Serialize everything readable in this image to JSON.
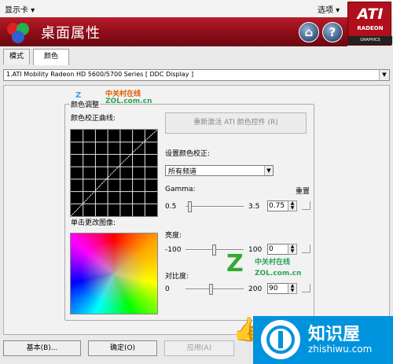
{
  "menubar": {
    "left_menu": "显示卡 ▾",
    "right_menu": "选项 ▾"
  },
  "header": {
    "title": "桌面属性"
  },
  "logo": {
    "brand": "ATI",
    "sub": "RADEON",
    "tag": "GRAPHICS"
  },
  "tabs": [
    {
      "label": "模式"
    },
    {
      "label": "颜色"
    }
  ],
  "display": {
    "selected": "1.ATI Mobility Radeon HD 5600/5700 Series [ DDC Display ]"
  },
  "color_adjust": {
    "group_title": "颜色调整",
    "curve_label": "颜色校正曲线:",
    "click_image_label": "单击更改图像:",
    "reactivate_button": "重新激活 ATI 颜色控件 (R)",
    "set_correction_label": "设置颜色校正:",
    "channel_selected": "所有频道",
    "reset_label": "重置",
    "gamma": {
      "label": "Gamma:",
      "min": "0.5",
      "max": "3.5",
      "value": "0.75",
      "fraction": 0.08
    },
    "brightness": {
      "label": "亮度:",
      "min": "-100",
      "max": "100",
      "value": "0",
      "fraction": 0.5
    },
    "contrast": {
      "label": "对比度:",
      "min": "0",
      "max": "200",
      "value": "90",
      "fraction": 0.45
    }
  },
  "buttons": {
    "basic": "基本(B)...",
    "ok": "确定(O)",
    "apply": "应用(A)"
  },
  "watermarks": {
    "zol_cn": "中关村在线",
    "zol_site": "ZOL.com.cn",
    "zhishi_title": "知识屋",
    "zhishi_url": "zhishiwu.com"
  }
}
